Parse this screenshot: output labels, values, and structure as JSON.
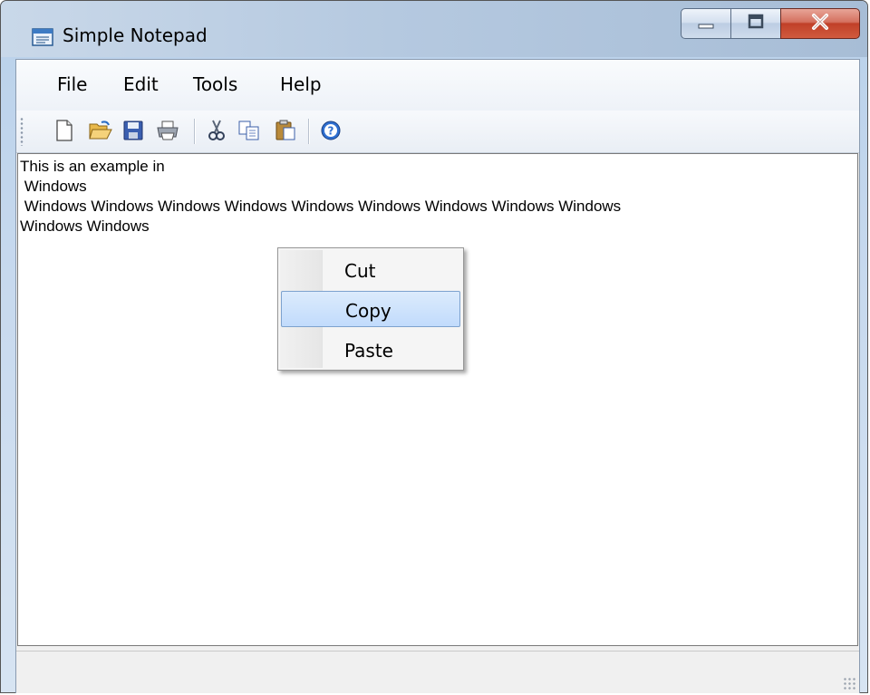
{
  "window": {
    "title": "Simple Notepad",
    "controls": {
      "minimize": "minimize",
      "maximize": "maximize",
      "close": "close"
    }
  },
  "menubar": {
    "items": [
      {
        "label": "File"
      },
      {
        "label": "Edit"
      },
      {
        "label": "Tools"
      },
      {
        "label": "Help"
      }
    ]
  },
  "toolbar": {
    "buttons": [
      {
        "icon": "new-document-icon",
        "tooltip": "New"
      },
      {
        "icon": "open-folder-icon",
        "tooltip": "Open"
      },
      {
        "icon": "save-disk-icon",
        "tooltip": "Save"
      },
      {
        "icon": "printer-icon",
        "tooltip": "Print"
      },
      {
        "icon": "scissors-icon",
        "tooltip": "Cut"
      },
      {
        "icon": "copy-pages-icon",
        "tooltip": "Copy"
      },
      {
        "icon": "paste-clipboard-icon",
        "tooltip": "Paste"
      },
      {
        "icon": "help-circle-icon",
        "tooltip": "Help"
      }
    ]
  },
  "editor": {
    "lines": [
      "This is an example in",
      " Windows",
      " Windows Windows Windows Windows Windows Windows Windows Windows Windows",
      "Windows Windows"
    ]
  },
  "context_menu": {
    "items": [
      {
        "label": "Cut",
        "highlighted": false
      },
      {
        "label": "Copy",
        "highlighted": true
      },
      {
        "label": "Paste",
        "highlighted": false
      }
    ]
  },
  "colors": {
    "highlight": "#c1dbfc",
    "highlight_border": "#7da2ce",
    "close_button": "#c04028"
  }
}
